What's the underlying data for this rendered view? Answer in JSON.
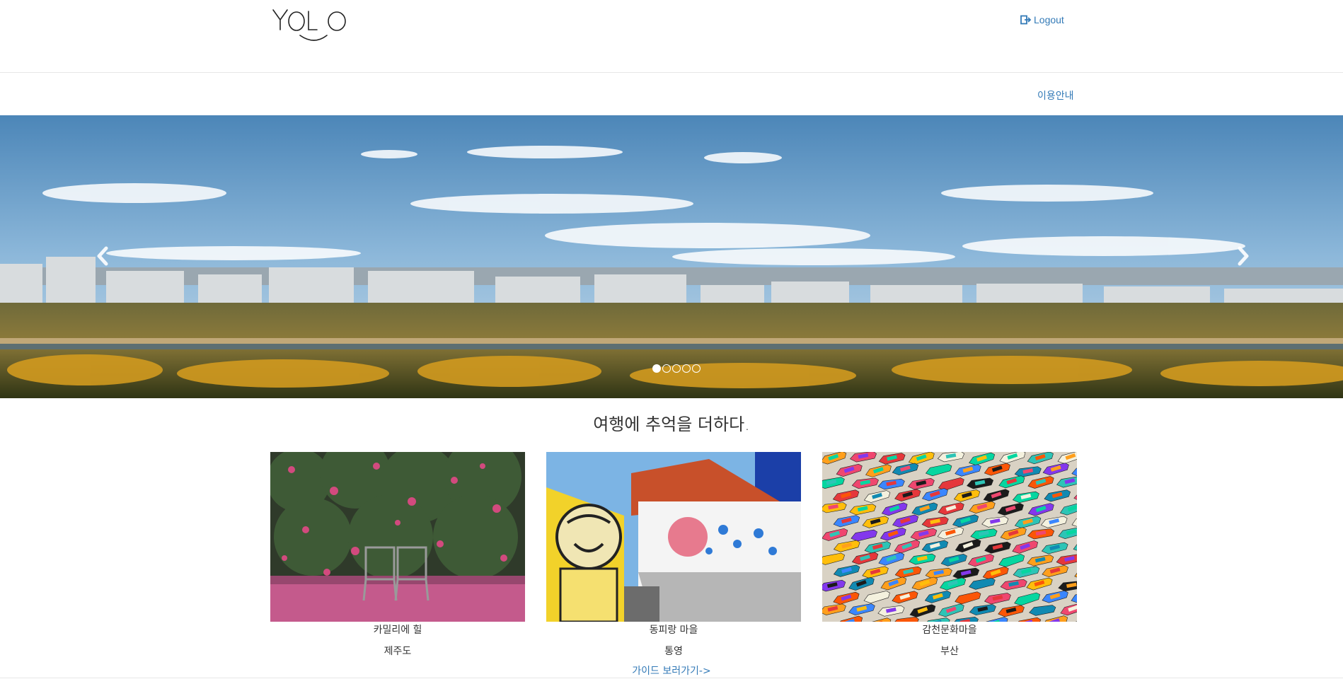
{
  "header": {
    "logo_text": "YOLO",
    "logout_label": "Logout",
    "logout_icon": "logout-icon"
  },
  "nav": {
    "guide_label": "이용안내"
  },
  "carousel": {
    "slide_count": 5,
    "active_index": 0,
    "prev_icon": "chevron-left-icon",
    "next_icon": "chevron-right-icon"
  },
  "main": {
    "title": "여행에 추억을 더하다.",
    "cards": [
      {
        "name": "카밀리에 힐",
        "region": "제주도"
      },
      {
        "name": "동피랑 마을",
        "region": "통영"
      },
      {
        "name": "감천문화마을",
        "region": "부산"
      }
    ],
    "guide_more_label": "가이드 보러가기->"
  },
  "colors": {
    "link": "#337ab7",
    "border": "#e7e7e7",
    "text": "#333333"
  }
}
